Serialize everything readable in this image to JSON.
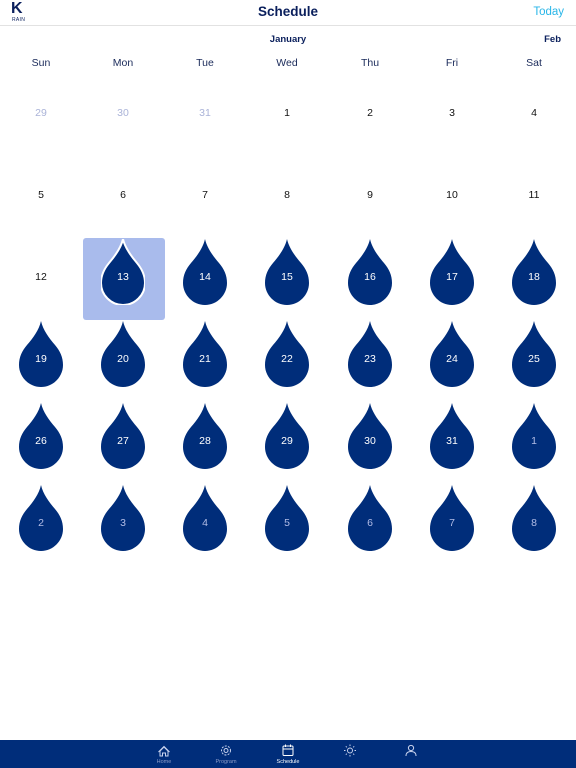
{
  "header": {
    "logo_letter": "K",
    "logo_sub": "RAIN",
    "title": "Schedule",
    "today_label": "Today"
  },
  "calendar": {
    "current_month": "January",
    "next_month": "Feb",
    "weekdays": [
      "Sun",
      "Mon",
      "Tue",
      "Wed",
      "Thu",
      "Fri",
      "Sat"
    ],
    "weeks": [
      [
        {
          "day": "29",
          "muted": true,
          "water": false
        },
        {
          "day": "30",
          "muted": true,
          "water": false
        },
        {
          "day": "31",
          "muted": true,
          "water": false
        },
        {
          "day": "1",
          "muted": false,
          "water": false
        },
        {
          "day": "2",
          "muted": false,
          "water": false
        },
        {
          "day": "3",
          "muted": false,
          "water": false
        },
        {
          "day": "4",
          "muted": false,
          "water": false
        }
      ],
      [
        {
          "day": "5",
          "muted": false,
          "water": false
        },
        {
          "day": "6",
          "muted": false,
          "water": false
        },
        {
          "day": "7",
          "muted": false,
          "water": false
        },
        {
          "day": "8",
          "muted": false,
          "water": false
        },
        {
          "day": "9",
          "muted": false,
          "water": false
        },
        {
          "day": "10",
          "muted": false,
          "water": false
        },
        {
          "day": "11",
          "muted": false,
          "water": false
        }
      ],
      [
        {
          "day": "12",
          "muted": false,
          "water": false
        },
        {
          "day": "13",
          "muted": false,
          "water": true,
          "selected": true
        },
        {
          "day": "14",
          "muted": false,
          "water": true
        },
        {
          "day": "15",
          "muted": false,
          "water": true
        },
        {
          "day": "16",
          "muted": false,
          "water": true
        },
        {
          "day": "17",
          "muted": false,
          "water": true
        },
        {
          "day": "18",
          "muted": false,
          "water": true
        }
      ],
      [
        {
          "day": "19",
          "muted": false,
          "water": true
        },
        {
          "day": "20",
          "muted": false,
          "water": true
        },
        {
          "day": "21",
          "muted": false,
          "water": true
        },
        {
          "day": "22",
          "muted": false,
          "water": true
        },
        {
          "day": "23",
          "muted": false,
          "water": true
        },
        {
          "day": "24",
          "muted": false,
          "water": true
        },
        {
          "day": "25",
          "muted": false,
          "water": true
        }
      ],
      [
        {
          "day": "26",
          "muted": false,
          "water": true
        },
        {
          "day": "27",
          "muted": false,
          "water": true
        },
        {
          "day": "28",
          "muted": false,
          "water": true
        },
        {
          "day": "29",
          "muted": false,
          "water": true
        },
        {
          "day": "30",
          "muted": false,
          "water": true
        },
        {
          "day": "31",
          "muted": false,
          "water": true
        },
        {
          "day": "1",
          "muted": true,
          "water": true
        }
      ],
      [
        {
          "day": "2",
          "muted": true,
          "water": true
        },
        {
          "day": "3",
          "muted": true,
          "water": true
        },
        {
          "day": "4",
          "muted": true,
          "water": true
        },
        {
          "day": "5",
          "muted": true,
          "water": true
        },
        {
          "day": "6",
          "muted": true,
          "water": true
        },
        {
          "day": "7",
          "muted": true,
          "water": true
        },
        {
          "day": "8",
          "muted": true,
          "water": true
        }
      ]
    ]
  },
  "tabbar": {
    "tabs": [
      {
        "name": "tab-home",
        "label": "Home",
        "icon": "home-icon",
        "active": false
      },
      {
        "name": "tab-program",
        "label": "Program",
        "icon": "gear-icon",
        "active": false
      },
      {
        "name": "tab-schedule",
        "label": "Schedule",
        "icon": "calendar-icon",
        "active": true
      },
      {
        "name": "tab-weather",
        "label": "",
        "icon": "sun-icon",
        "active": false
      },
      {
        "name": "tab-account",
        "label": "",
        "icon": "person-icon",
        "active": false
      }
    ]
  },
  "colors": {
    "brand": "#002d7a",
    "drop": "#002d7a",
    "accent": "#29b6e8",
    "selected": "#a9bbec",
    "muted": "#aab3d8"
  }
}
